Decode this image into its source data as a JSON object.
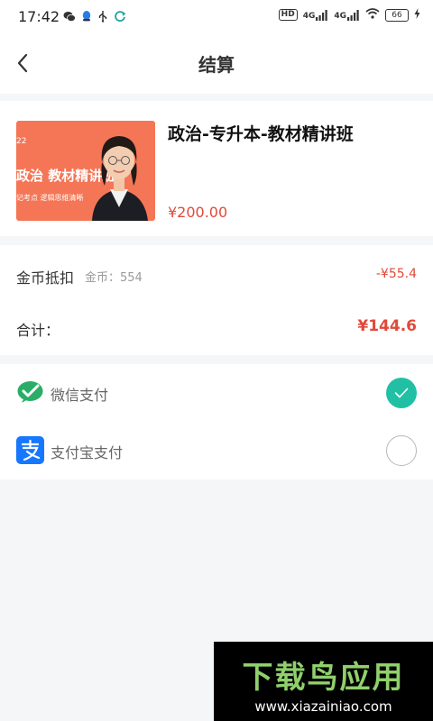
{
  "status_bar": {
    "time": "17:42",
    "hd_label": "HD",
    "network_1": "4G",
    "network_2": "4G",
    "battery": "66",
    "left_icons": [
      "wechat-icon",
      "qq-icon",
      "usb-icon",
      "sync-icon"
    ]
  },
  "header": {
    "title": "结算"
  },
  "product": {
    "name": "政治-专升本-教材精讲班",
    "price": "¥200.00",
    "thumbnail": {
      "year": "22",
      "title": "政治 教材精讲班",
      "subtitle": "记考点  逻辑思维清晰",
      "background_color": "#f47656"
    }
  },
  "pricing": {
    "coin_label": "金币抵扣",
    "coin_balance": "金币：554",
    "coin_discount": "-¥55.4",
    "total_label": "合计：",
    "total_value": "¥144.6"
  },
  "payment": {
    "options": [
      {
        "label": "微信支付",
        "icon": "wechat-pay-icon",
        "selected": true
      },
      {
        "label": "支付宝支付",
        "icon": "alipay-icon",
        "selected": false
      }
    ]
  },
  "watermark": {
    "title": "下载鸟应用",
    "url": "www.xiazainiao.com"
  },
  "colors": {
    "accent": "#21c0a4",
    "price_red": "#e04a3a",
    "wechat_green": "#2aae67",
    "alipay_blue": "#1677ff"
  }
}
